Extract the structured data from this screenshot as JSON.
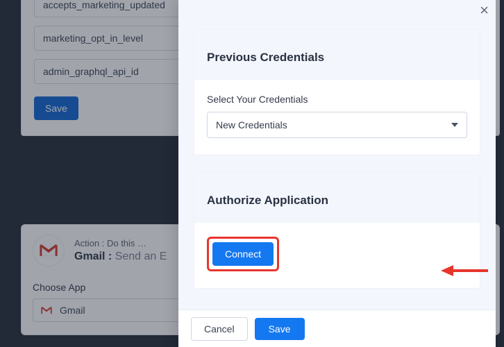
{
  "fields": {
    "item0": "accepts_marketing_updated",
    "item1": "marketing_opt_in_level",
    "item2": "admin_graphql_api_id",
    "save_label": "Save"
  },
  "action": {
    "line1": "Action : Do this …",
    "app_name": "Gmail : ",
    "app_action": "Send an E",
    "choose_app_label": "Choose App",
    "selected_app": "Gmail"
  },
  "drawer": {
    "previous_title": "Previous Credentials",
    "select_label": "Select Your Credentials",
    "select_value": "New Credentials",
    "authorize_title": "Authorize Application",
    "connect_label": "Connect",
    "cancel_label": "Cancel",
    "save_label": "Save"
  }
}
